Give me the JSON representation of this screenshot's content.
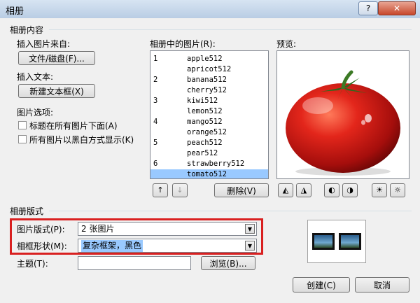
{
  "window": {
    "title": "相册",
    "help_label": "?",
    "close_label": "✕"
  },
  "album_content": {
    "group_label": "相册内容",
    "insert_from_label": "插入图片来自:",
    "file_disk_button": "文件/磁盘(F)...",
    "insert_text_label": "插入文本:",
    "new_textbox_button": "新建文本框(X)",
    "picture_options_label": "图片选项:",
    "caption_below_label": "标题在所有图片下面(A)",
    "caption_below_checked": false,
    "black_white_label": "所有图片以黑白方式显示(K)",
    "black_white_checked": false,
    "pictures_list_label": "相册中的图片(R):",
    "pictures": [
      {
        "num": "1",
        "name": "apple512"
      },
      {
        "num": "",
        "name": "apricot512"
      },
      {
        "num": "2",
        "name": "banana512"
      },
      {
        "num": "",
        "name": "cherry512"
      },
      {
        "num": "3",
        "name": "kiwi512"
      },
      {
        "num": "",
        "name": "lemon512"
      },
      {
        "num": "4",
        "name": "mango512"
      },
      {
        "num": "",
        "name": "orange512"
      },
      {
        "num": "5",
        "name": "peach512"
      },
      {
        "num": "",
        "name": "pear512"
      },
      {
        "num": "6",
        "name": "strawberry512"
      },
      {
        "num": "",
        "name": "tomato512"
      }
    ],
    "selected_picture": "tomato512",
    "move_up_icon": "arrow-up-icon",
    "move_down_icon": "arrow-down-icon",
    "remove_button": "删除(V)",
    "preview_label": "预览:"
  },
  "album_layout": {
    "group_label": "相册版式",
    "picture_layout_label": "图片版式(P):",
    "picture_layout_value": "2 张图片",
    "frame_shape_label": "相框形状(M):",
    "frame_shape_value": "复杂框架，黑色",
    "theme_label": "主题(T):",
    "theme_value": "",
    "browse_button": "浏览(B)..."
  },
  "footer": {
    "create_button": "创建(C)",
    "cancel_button": "取消"
  },
  "colors": {
    "highlight_border": "#d92020",
    "selection": "#99c9ff"
  }
}
